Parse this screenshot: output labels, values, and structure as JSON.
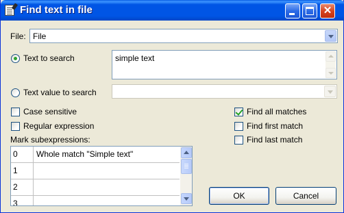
{
  "window": {
    "title": "Find text in file"
  },
  "file": {
    "label": "File:",
    "value": "File"
  },
  "text_to_search": {
    "label": "Text to search",
    "checked": true,
    "value": "simple text"
  },
  "text_value_to_search": {
    "label": "Text value to search",
    "checked": false,
    "value": ""
  },
  "options": {
    "case_sensitive": {
      "label": "Case sensitive",
      "checked": false
    },
    "regular_expression": {
      "label": "Regular expression",
      "checked": false
    },
    "find_all_matches": {
      "label": "Find all matches",
      "checked": true
    },
    "find_first_match": {
      "label": "Find first match",
      "checked": false
    },
    "find_last_match": {
      "label": "Find last match",
      "checked": false
    }
  },
  "subexpressions": {
    "label": "Mark subexpressions:",
    "rows": [
      {
        "index": "0",
        "text": "Whole match \"Simple text\""
      },
      {
        "index": "1",
        "text": ""
      },
      {
        "index": "2",
        "text": ""
      },
      {
        "index": "3",
        "text": ""
      }
    ]
  },
  "buttons": {
    "ok": "OK",
    "cancel": "Cancel"
  },
  "icons": {
    "window": "document-pencil-icon",
    "minimize": "minimize-icon",
    "maximize": "maximize-icon",
    "close": "close-icon"
  },
  "colors": {
    "titlebar": "#0055E5",
    "dialog_bg": "#ECE9D8",
    "check_green": "#21A121"
  }
}
